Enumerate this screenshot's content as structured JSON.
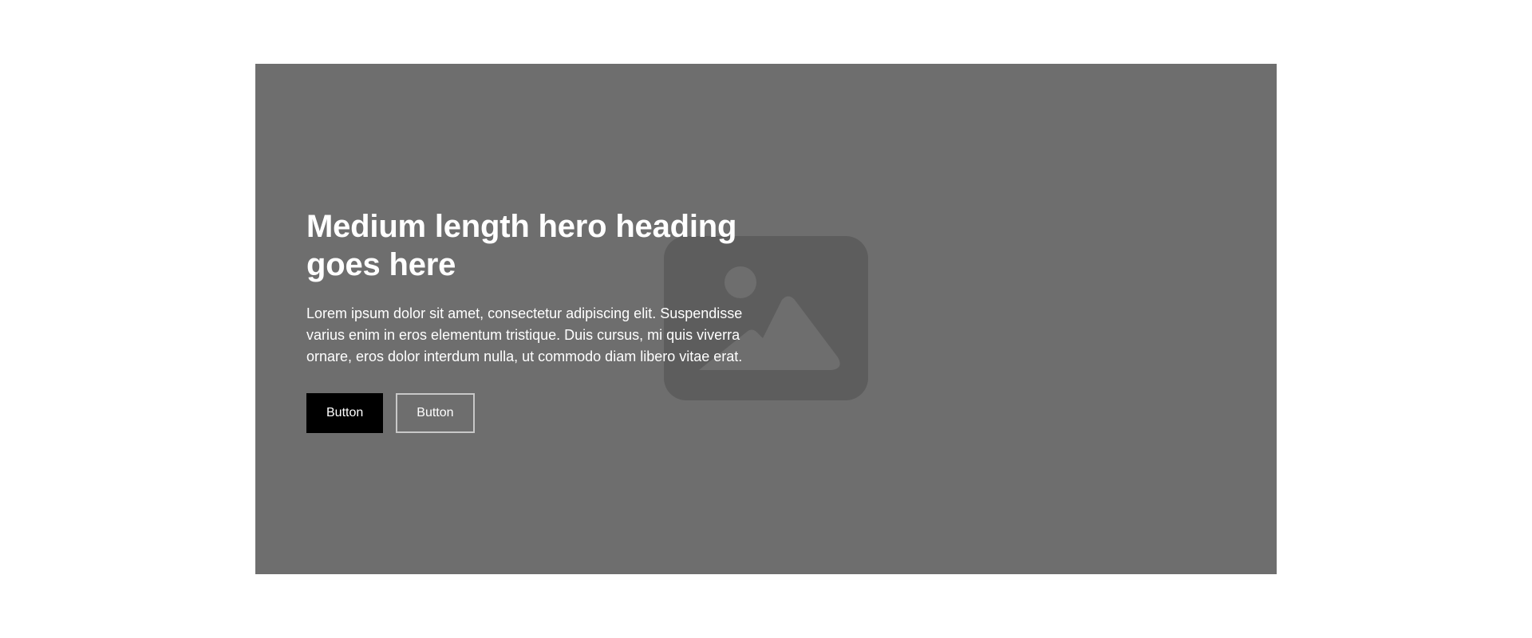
{
  "hero": {
    "heading": "Medium length hero heading goes here",
    "text": "Lorem ipsum dolor sit amet, consectetur adipiscing elit. Suspendisse varius enim in eros elementum tristique. Duis cursus, mi quis viverra ornare, eros dolor interdum nulla, ut commodo diam libero vitae erat.",
    "primary_button_label": "Button",
    "secondary_button_label": "Button",
    "image_icon": "image-placeholder-icon"
  },
  "colors": {
    "page_background": "#ffffff",
    "hero_background": "#6e6e6e",
    "placeholder_shape": "#5d5d5d",
    "placeholder_glyph": "#6e6e6e",
    "text": "#ffffff",
    "primary_button": "#000000",
    "secondary_button_border": "#c8c8c8"
  }
}
